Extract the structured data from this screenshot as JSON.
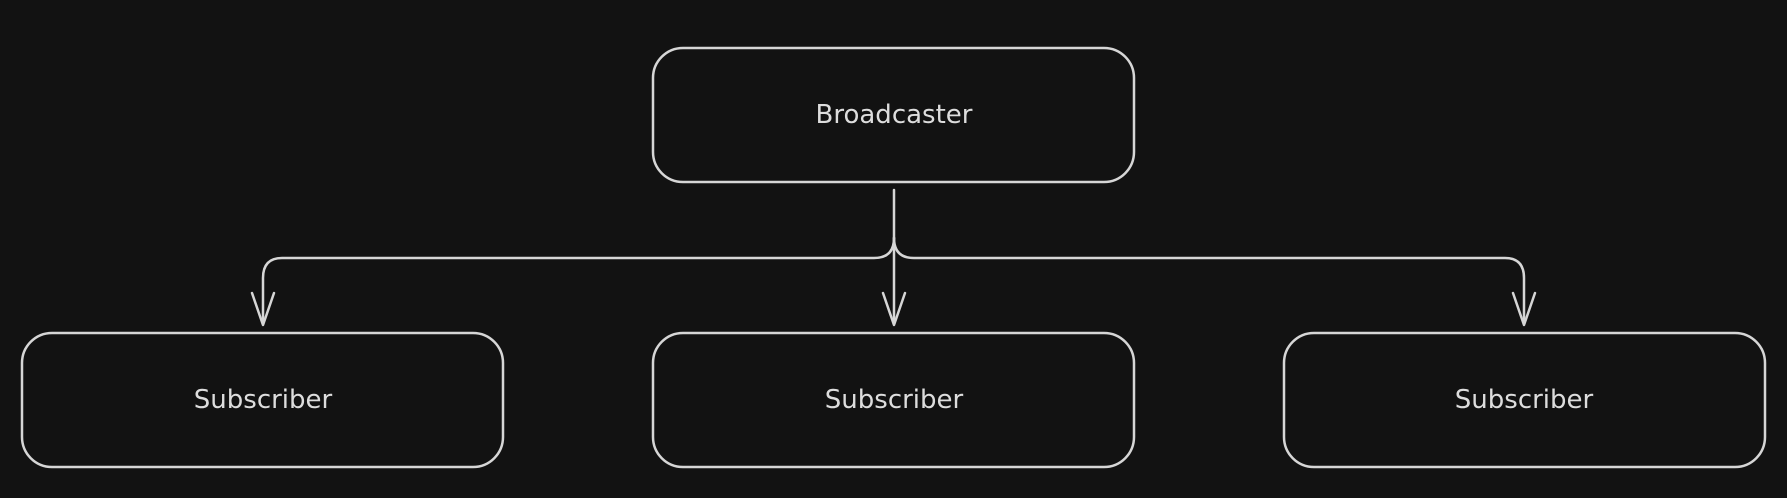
{
  "diagram": {
    "root": {
      "label": "Broadcaster"
    },
    "children": [
      {
        "label": "Subscriber"
      },
      {
        "label": "Subscriber"
      },
      {
        "label": "Subscriber"
      }
    ],
    "colors": {
      "background": "#121212",
      "stroke": "#d6d6d6",
      "text": "#dddddd"
    }
  }
}
